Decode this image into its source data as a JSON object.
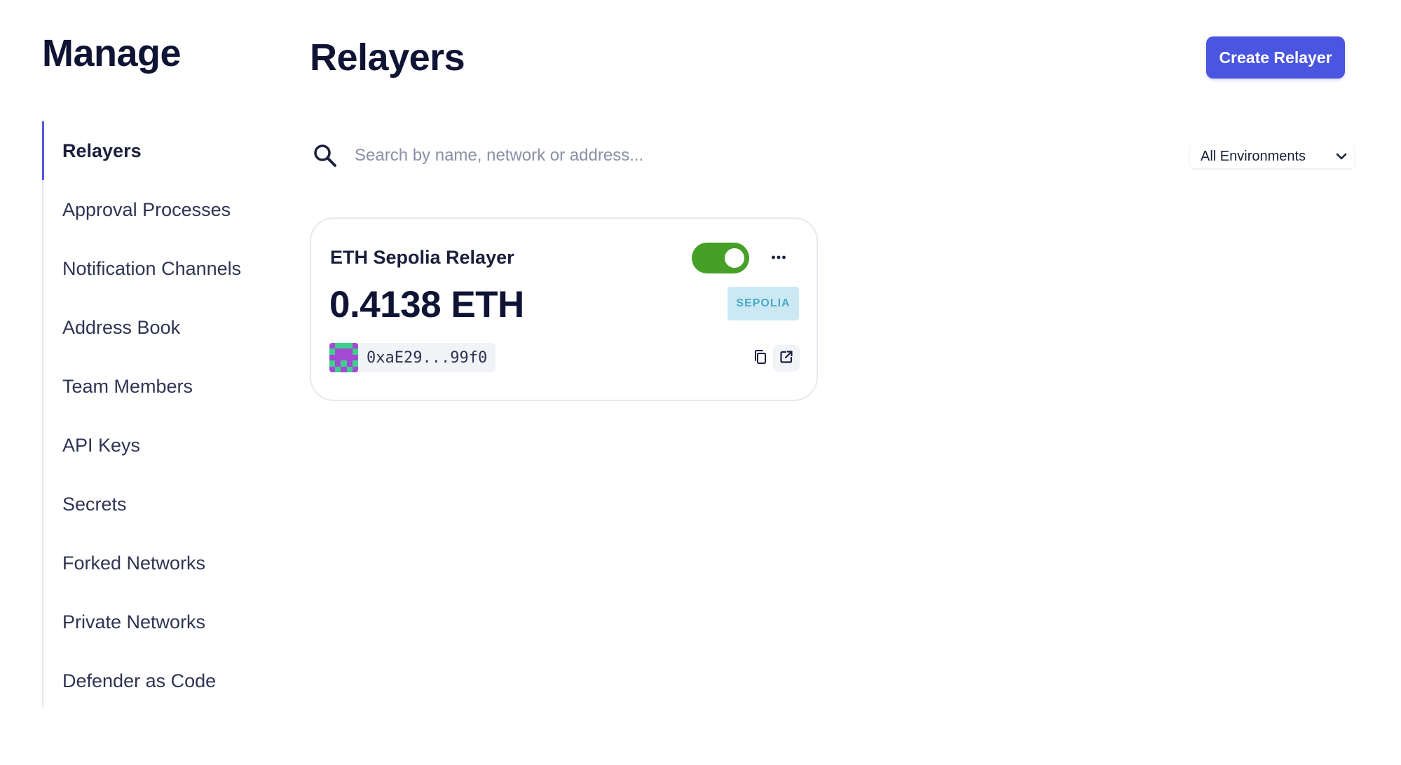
{
  "sidebar": {
    "title": "Manage",
    "items": [
      {
        "label": "Relayers",
        "active": true
      },
      {
        "label": "Approval Processes",
        "active": false
      },
      {
        "label": "Notification Channels",
        "active": false
      },
      {
        "label": "Address Book",
        "active": false
      },
      {
        "label": "Team Members",
        "active": false
      },
      {
        "label": "API Keys",
        "active": false
      },
      {
        "label": "Secrets",
        "active": false
      },
      {
        "label": "Forked Networks",
        "active": false
      },
      {
        "label": "Private Networks",
        "active": false
      },
      {
        "label": "Defender as Code",
        "active": false
      }
    ]
  },
  "main": {
    "title": "Relayers",
    "create_button_label": "Create Relayer",
    "search": {
      "value": "",
      "placeholder": "Search by name, network or address...",
      "icon": "search-icon"
    },
    "environment_select": {
      "selected": "All Environments",
      "icon": "chevron-down-icon"
    }
  },
  "relayers": [
    {
      "name": "ETH Sepolia Relayer",
      "enabled": true,
      "balance": "0.4138 ETH",
      "network": "SEPOLIA",
      "address": "0xaE29...99f0",
      "icons": {
        "more": "more-horizontal-icon",
        "copy": "copy-icon",
        "explorer": "external-link-icon",
        "avatar": "identicon"
      }
    }
  ],
  "colors": {
    "accent": "#4a55e0",
    "active_indicator": "#5159d6",
    "toggle_on": "#46a027",
    "badge_bg": "#cce9f3",
    "badge_text": "#4aa9c9",
    "title_text": "#0f1434",
    "identicon_primary": "#a349d4",
    "identicon_secondary": "#3ecf8e"
  }
}
